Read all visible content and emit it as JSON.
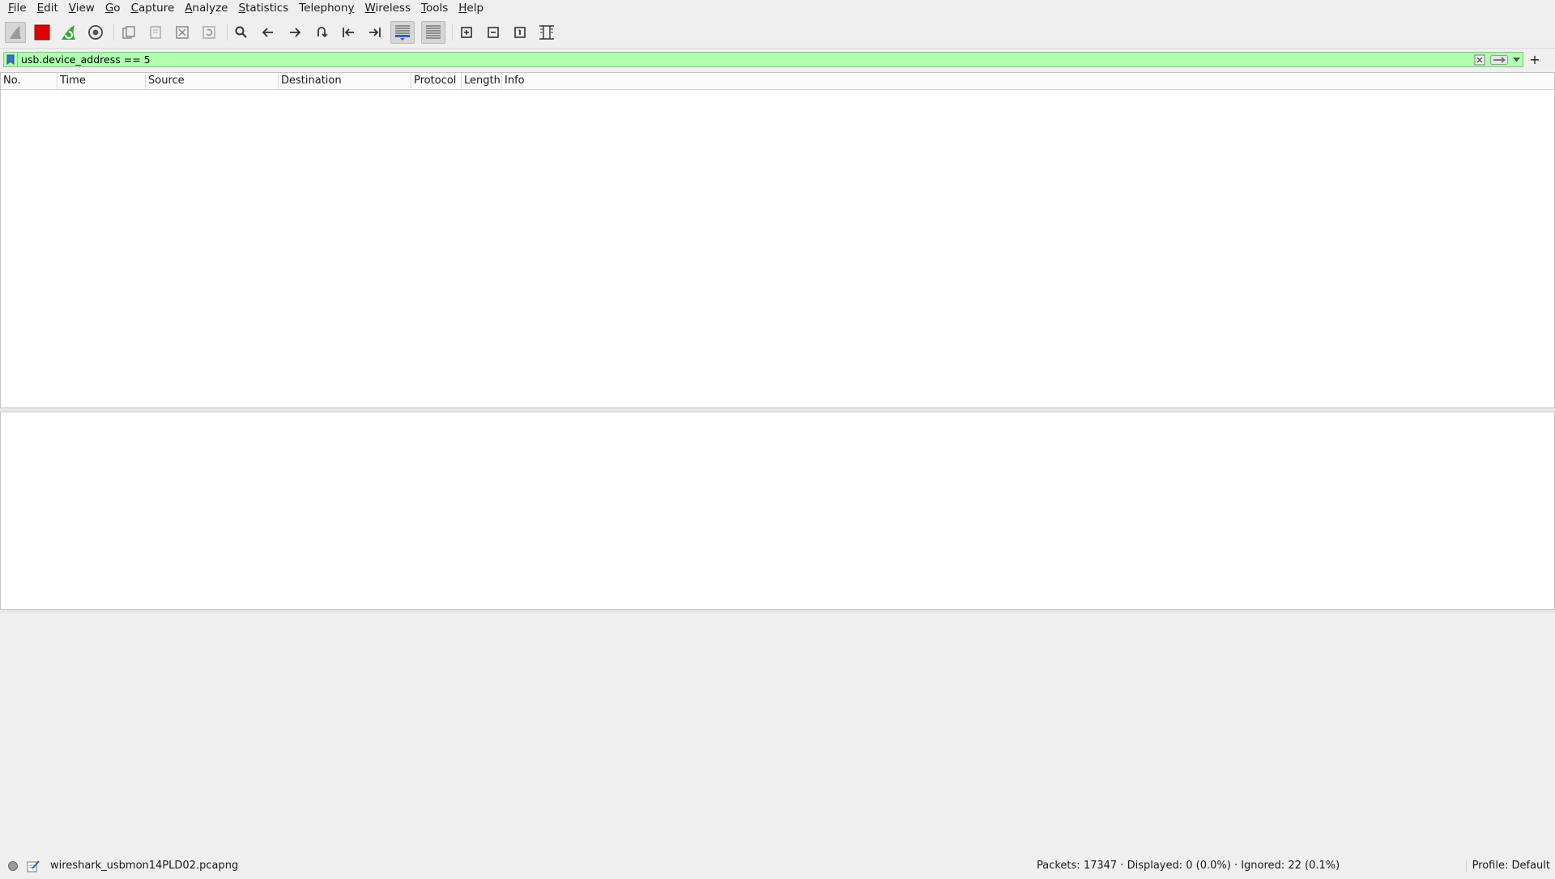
{
  "menu": [
    {
      "pre": "",
      "u": "F",
      "post": "ile"
    },
    {
      "pre": "",
      "u": "E",
      "post": "dit"
    },
    {
      "pre": "",
      "u": "V",
      "post": "iew"
    },
    {
      "pre": "",
      "u": "G",
      "post": "o"
    },
    {
      "pre": "",
      "u": "C",
      "post": "apture"
    },
    {
      "pre": "",
      "u": "A",
      "post": "nalyze"
    },
    {
      "pre": "",
      "u": "S",
      "post": "tatistics"
    },
    {
      "pre": "Telephon",
      "u": "y",
      "post": ""
    },
    {
      "pre": "",
      "u": "W",
      "post": "ireless"
    },
    {
      "pre": "",
      "u": "T",
      "post": "ools"
    },
    {
      "pre": "",
      "u": "H",
      "post": "elp"
    }
  ],
  "toolbar": {
    "icons": [
      "shark-fin-icon",
      "stop-square-icon",
      "restart-fin-icon",
      "gear-icon",
      "open-file-icon",
      "save-file-icon",
      "close-file-icon",
      "reload-icon",
      "search-icon",
      "arrow-left-icon",
      "arrow-right-icon",
      "go-to-packet-icon",
      "first-packet-icon",
      "last-packet-icon",
      "autoscroll-icon",
      "colorize-icon",
      "zoom-in-icon",
      "zoom-out-icon",
      "normal-size-icon",
      "resize-columns-icon"
    ]
  },
  "filter": {
    "value": "usb.device_address == 5",
    "background": "#afffaf"
  },
  "columns": [
    "No.",
    "Time",
    "Source",
    "Destination",
    "Protocol",
    "Length",
    "Info"
  ],
  "status": {
    "file": "wireshark_usbmon14PLD02.pcapng",
    "packets": "Packets: 17347 · Displayed: 0 (0.0%) · Ignored: 22 (0.1%)",
    "profile": "Profile: Default"
  }
}
